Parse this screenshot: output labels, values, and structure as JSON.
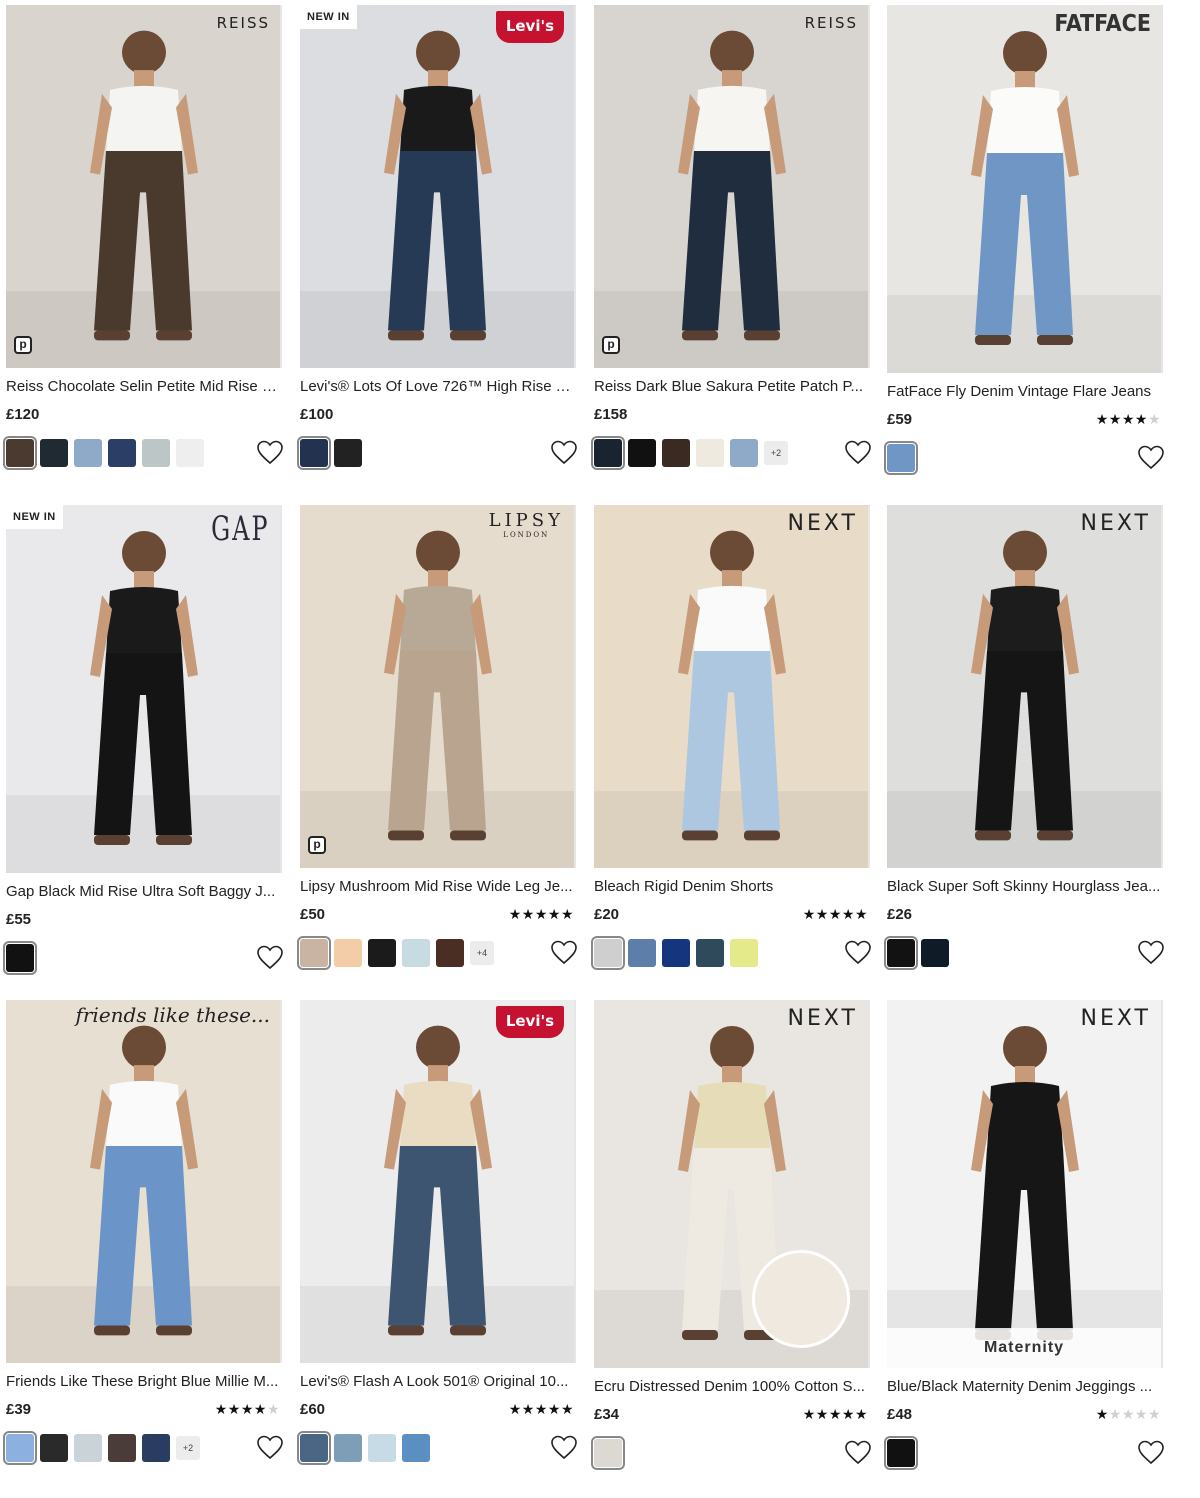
{
  "products": [
    {
      "brand": "REISS",
      "brand_style": "reiss",
      "new_in": "",
      "premium_badge": true,
      "title": "Reiss Chocolate Selin Petite Mid Rise S...",
      "price": "£120",
      "rating": 0,
      "more": "",
      "image_bg": "#d9d4cd",
      "garment": "#4a3a2e",
      "top": "#f4f4f2",
      "swatches": [
        "#4b3a2f",
        "#1f2a33",
        "#8eaac8",
        "#2b3f66",
        "#bdc6c6",
        "#eeeeee"
      ]
    },
    {
      "brand": "Levi's",
      "brand_style": "levis",
      "new_in": "NEW IN",
      "premium_badge": false,
      "title": "Levi's® Lots Of Love 726™ High Rise Yo...",
      "price": "£100",
      "rating": 0,
      "more": "",
      "image_bg": "#dcdde0",
      "garment": "#263a55",
      "top": "#1a1a1a",
      "swatches": [
        "#22324f",
        "#222222"
      ]
    },
    {
      "brand": "REISS",
      "brand_style": "reiss",
      "new_in": "",
      "premium_badge": true,
      "title": "Reiss Dark Blue Sakura Petite Patch P...",
      "price": "£158",
      "rating": 0,
      "more": "+2",
      "image_bg": "#d8d5d1",
      "garment": "#1f2d3f",
      "top": "#f6f5f1",
      "swatches": [
        "#1a2330",
        "#111111",
        "#3a2a22",
        "#efeae0",
        "#8eaac8"
      ]
    },
    {
      "brand": "FATFACE",
      "brand_style": "fatface",
      "new_in": "",
      "premium_badge": false,
      "title": "FatFace Fly Denim Vintage Flare Jeans",
      "price": "£59",
      "rating": 4,
      "more": "",
      "image_bg": "#e7e6e3",
      "garment": "#6f96c4",
      "top": "#fbfbf9",
      "swatches": [
        "#6f96c4"
      ]
    },
    {
      "brand": "GAP",
      "brand_style": "gap",
      "new_in": "NEW IN",
      "premium_badge": false,
      "title": "Gap Black Mid Rise Ultra Soft Baggy J...",
      "price": "£55",
      "rating": 0,
      "more": "",
      "image_bg": "#e9e9ec",
      "garment": "#141414",
      "top": "#1a1a1a",
      "swatches": [
        "#111111"
      ]
    },
    {
      "brand": "LIPSY",
      "brand_sub": "LONDON",
      "brand_style": "lipsy",
      "new_in": "",
      "premium_badge": true,
      "title": "Lipsy Mushroom Mid Rise Wide Leg Je...",
      "price": "£50",
      "rating": 5,
      "more": "+4",
      "image_bg": "#e6dccd",
      "garment": "#b9a58f",
      "top": "#b7a995",
      "swatches": [
        "#c9b3a2",
        "#f3cda8",
        "#1b1b1b",
        "#c9dbe2",
        "#4a2e24"
      ]
    },
    {
      "brand": "NEXT",
      "brand_style": "next",
      "new_in": "",
      "premium_badge": false,
      "title": "Bleach Rigid Denim Shorts",
      "price": "£20",
      "rating": 5,
      "more": "",
      "image_bg": "#e8dcc9",
      "garment": "#aec7e0",
      "top": "#fafafa",
      "swatches": [
        "#cfcfcf",
        "#5d7ea8",
        "#16357f",
        "#2f4a5a",
        "#e4ea8a"
      ]
    },
    {
      "brand": "NEXT",
      "brand_style": "next",
      "new_in": "",
      "premium_badge": false,
      "title": "Black Super Soft Skinny Hourglass Jea...",
      "price": "£26",
      "rating": 0,
      "more": "",
      "image_bg": "#dededc",
      "garment": "#151515",
      "top": "#1c1c1c",
      "swatches": [
        "#121212",
        "#0f1c28"
      ]
    },
    {
      "brand": "friends like these...",
      "brand_style": "friends",
      "new_in": "",
      "premium_badge": false,
      "title": "Friends Like These Bright Blue Millie M...",
      "price": "£39",
      "rating": 4,
      "more": "+2",
      "image_bg": "#e7dfd2",
      "garment": "#6b95c8",
      "top": "#fafafa",
      "swatches": [
        "#8cb0df",
        "#2a2a2a",
        "#c9d3d8",
        "#4a3c38",
        "#2a3c62"
      ]
    },
    {
      "brand": "Levi's",
      "brand_style": "levis",
      "new_in": "",
      "premium_badge": false,
      "title": "Levi's® Flash A Look 501® Original 10...",
      "price": "£60",
      "rating": 5,
      "more": "",
      "image_bg": "#ececec",
      "garment": "#3e5572",
      "top": "#e9dcc2",
      "swatches": [
        "#4a6684",
        "#7e9db6",
        "#c6dbe6",
        "#5b8fc4"
      ]
    },
    {
      "brand": "NEXT",
      "brand_style": "next",
      "new_in": "",
      "premium_badge": false,
      "title": "Ecru Distressed Denim 100% Cotton S...",
      "price": "£34",
      "rating": 5,
      "more": "",
      "image_bg": "#e9e6e1",
      "garment": "#efeae1",
      "top": "#e6dcb8",
      "swatches": [
        "#dcd8d2"
      ]
    },
    {
      "brand": "NEXT",
      "brand_style": "next",
      "new_in": "",
      "premium_badge": false,
      "maternity_label": "Maternity",
      "title": "Blue/Black Maternity Denim Jeggings ...",
      "price": "£48",
      "rating": 1,
      "more": "",
      "image_bg": "#f2f2f2",
      "garment": "#161616",
      "top": "#161616",
      "swatches": [
        "#111111"
      ]
    }
  ]
}
